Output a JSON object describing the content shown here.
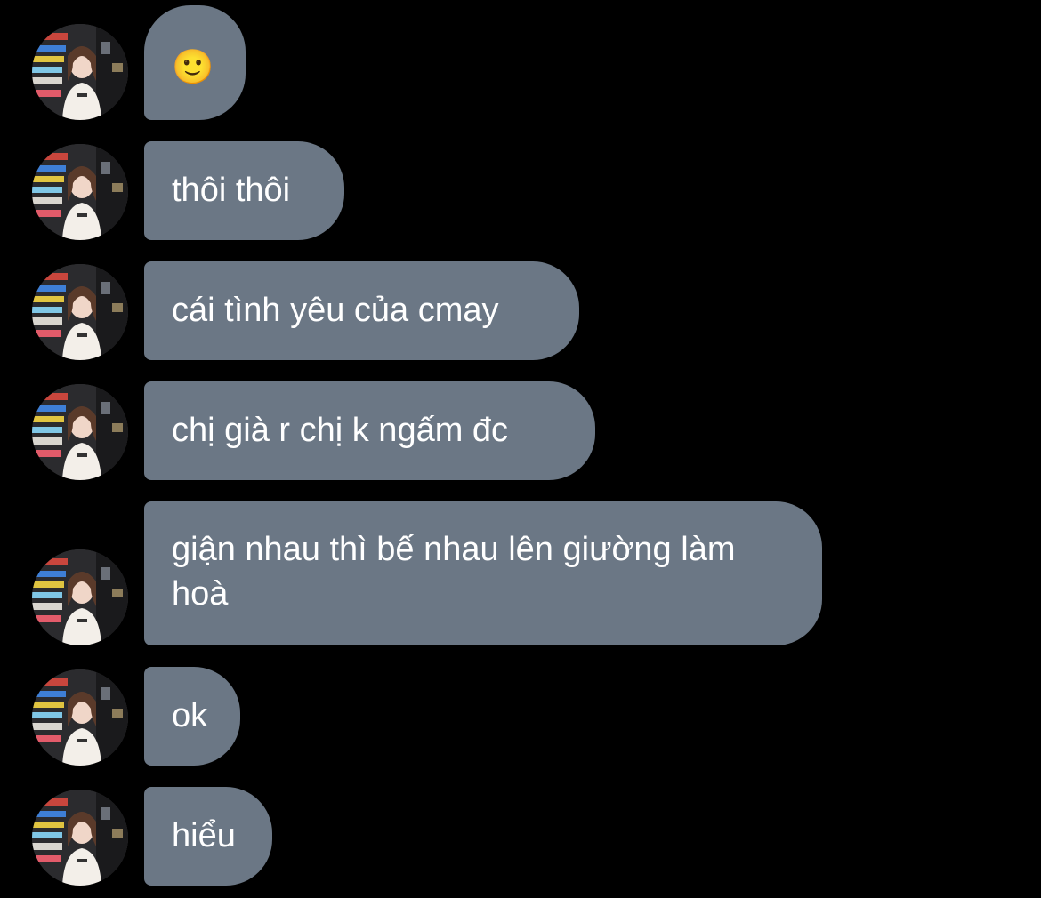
{
  "conversation": {
    "messages": [
      {
        "text": "🙂"
      },
      {
        "text": "thôi thôi"
      },
      {
        "text": "cái tình yêu của cmay"
      },
      {
        "text": "chị già r chị k ngấm đc"
      },
      {
        "text": "giận nhau thì bế nhau lên giường làm hoà"
      },
      {
        "text": "ok"
      },
      {
        "text": "hiểu"
      }
    ],
    "bubble_color": "#6b7785",
    "background_color": "#000000",
    "avatar_icon": "profile-photo-avatar"
  }
}
